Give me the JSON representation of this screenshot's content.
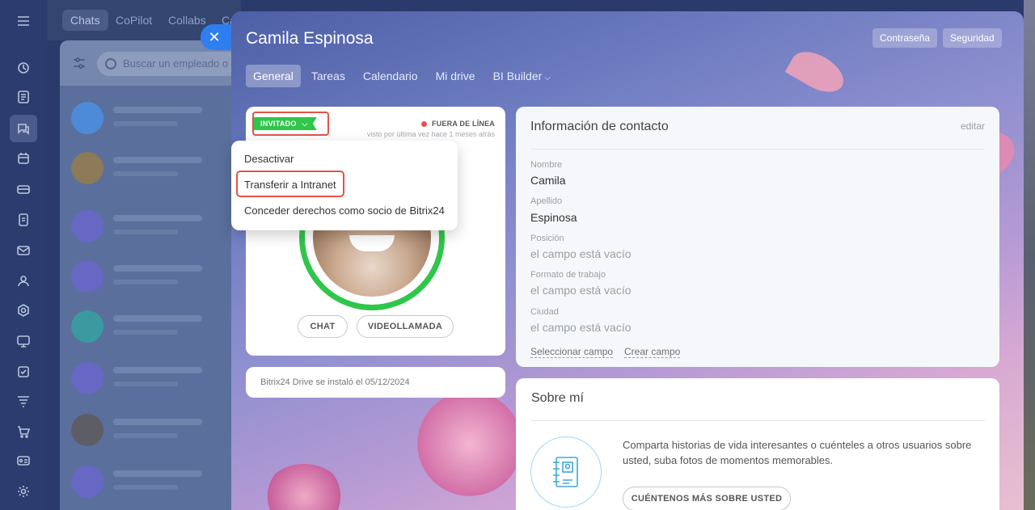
{
  "background": {
    "tabs": [
      "Chats",
      "CoPilot",
      "Collabs",
      "Ca"
    ],
    "search_placeholder": "Buscar un empleado o"
  },
  "slider": {
    "title": "Camila Espinosa",
    "header_buttons": [
      "Contraseña",
      "Seguridad"
    ],
    "tabs": [
      {
        "label": "General",
        "active": true
      },
      {
        "label": "Tareas"
      },
      {
        "label": "Calendario"
      },
      {
        "label": "Mi drive"
      },
      {
        "label": "BI Builder"
      }
    ],
    "tab_dropdown_glyph": "⌵"
  },
  "profile": {
    "status_badge": "INVITADO",
    "status_chevron": "⌵",
    "online_status": "FUERA DE LÍNEA",
    "last_seen": "visto por última vez hace 1 meses atrás",
    "chat_button": "CHAT",
    "video_button": "VIDEOLLAMADA",
    "status_color": "#2fc64a"
  },
  "drive_info": "Bitrix24 Drive se instaló el 05/12/2024",
  "dropdown": {
    "items": [
      "Desactivar",
      "Transferir a Intranet",
      "Conceder derechos como socio de Bitrix24"
    ]
  },
  "contact": {
    "title": "Información de contacto",
    "edit": "editar",
    "fields": [
      {
        "label": "Nombre",
        "value": "Camila"
      },
      {
        "label": "Apellido",
        "value": "Espinosa"
      },
      {
        "label": "Posición",
        "value": "el campo está vacío"
      },
      {
        "label": "Formato de trabajo",
        "value": "el campo está vacío"
      },
      {
        "label": "Ciudad",
        "value": "el campo está vacío"
      }
    ],
    "select_field": "Seleccionar campo",
    "create_field": "Crear campo"
  },
  "about": {
    "title": "Sobre mí",
    "text": "Comparta historias de vida interesantes o cuénteles a otros usuarios sobre usted, suba fotos de momentos memorables.",
    "button": "CUÉNTENOS MÁS SOBRE USTED"
  },
  "close_glyph": "✕",
  "accent_color": "#2f7ef0",
  "highlight_color": "#e0544b"
}
